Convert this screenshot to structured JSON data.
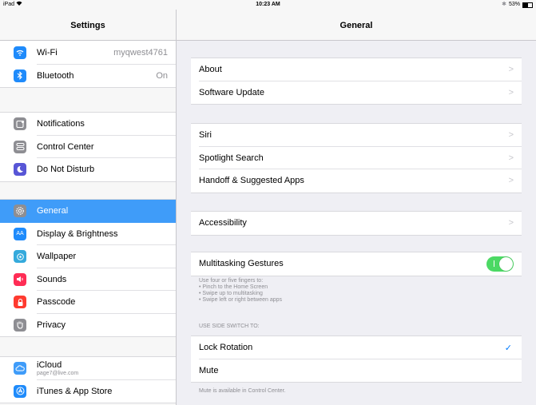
{
  "status": {
    "device": "iPad",
    "time": "10:23 AM",
    "battery": "53%",
    "battery_level": 0.53
  },
  "sidebar": {
    "title": "Settings",
    "groups": [
      [
        {
          "name": "Wi-Fi",
          "value": "myqwest4761",
          "icon": "wifi-icon",
          "color": "#1f8bfb"
        },
        {
          "name": "Bluetooth",
          "value": "On",
          "icon": "bluetooth-icon",
          "color": "#1f8bfb"
        }
      ],
      [
        {
          "name": "Notifications",
          "icon": "notifications-icon",
          "color": "#8e8e93"
        },
        {
          "name": "Control Center",
          "icon": "control-center-icon",
          "color": "#8e8e93"
        },
        {
          "name": "Do Not Disturb",
          "icon": "moon-icon",
          "color": "#5856d6"
        }
      ],
      [
        {
          "name": "General",
          "icon": "gear-icon",
          "color": "#8e8e93",
          "selected": true
        },
        {
          "name": "Display & Brightness",
          "icon": "display-icon",
          "color": "#1f8bfb"
        },
        {
          "name": "Wallpaper",
          "icon": "wallpaper-icon",
          "color": "#35aadc"
        },
        {
          "name": "Sounds",
          "icon": "speaker-icon",
          "color": "#ff2d55"
        },
        {
          "name": "Passcode",
          "icon": "lock-icon",
          "color": "#ff3b30"
        },
        {
          "name": "Privacy",
          "icon": "hand-icon",
          "color": "#8e8e93"
        }
      ],
      [
        {
          "name": "iCloud",
          "sub": "page7@live.com",
          "icon": "cloud-icon",
          "color": "#3f9cf9"
        },
        {
          "name": "iTunes & App Store",
          "icon": "app-store-icon",
          "color": "#1f8bfb"
        }
      ]
    ]
  },
  "detail": {
    "title": "General",
    "group1": [
      "About",
      "Software Update"
    ],
    "group2": [
      "Siri",
      "Spotlight Search",
      "Handoff & Suggested Apps"
    ],
    "group3": [
      "Accessibility"
    ],
    "multitasking": {
      "label": "Multitasking Gestures",
      "on": true
    },
    "multitasking_footer": [
      "Use four or five fingers to:",
      "• Pinch to the Home Screen",
      "• Swipe up to multitasking",
      "• Swipe left or right between apps"
    ],
    "side_switch_header": "USE SIDE SWITCH TO:",
    "side_switch": [
      {
        "label": "Lock Rotation",
        "checked": true
      },
      {
        "label": "Mute",
        "checked": false
      }
    ],
    "side_switch_footer": "Mute is available in Control Center.",
    "chevron": ">",
    "checkmark": "✓"
  }
}
